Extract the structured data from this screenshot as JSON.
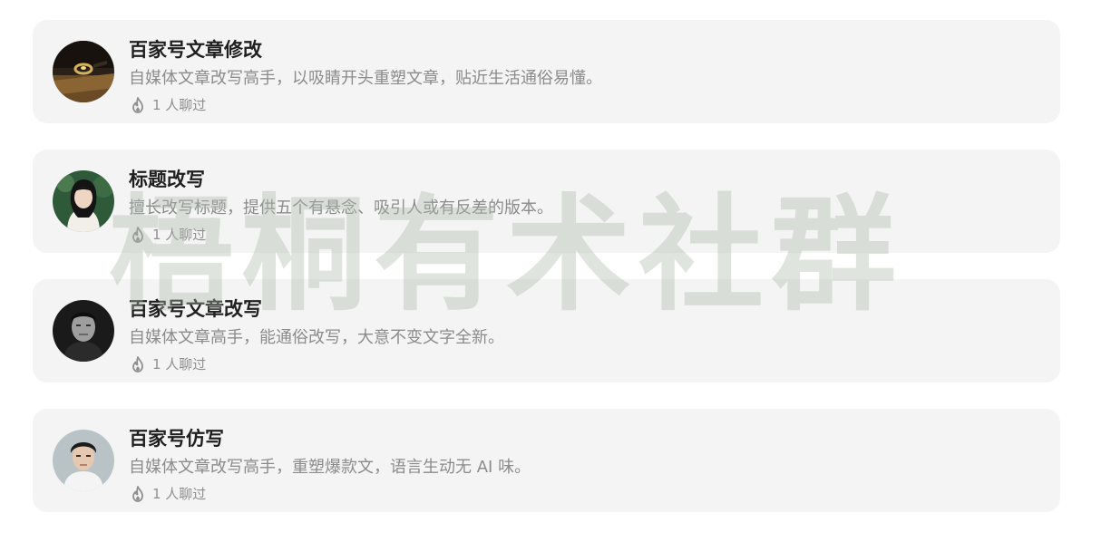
{
  "items": [
    {
      "title": "百家号文章修改",
      "description": "自媒体文章改写高手，以吸睛开头重塑文章，贴近生活通俗易懂。",
      "chat_count": "1 人聊过",
      "avatar": "gold-ring-photo"
    },
    {
      "title": "标题改写",
      "description": "擅长改写标题，提供五个有悬念、吸引人或有反差的版本。",
      "chat_count": "1 人聊过",
      "avatar": "young-woman-portrait"
    },
    {
      "title": "百家号文章改写",
      "description": "自媒体文章高手，能通俗改写，大意不变文字全新。",
      "chat_count": "1 人聊过",
      "avatar": "man-bw-portrait"
    },
    {
      "title": "百家号仿写",
      "description": "自媒体文章改写高手，重塑爆款文，语言生动无 AI 味。",
      "chat_count": "1 人聊过",
      "avatar": "young-man-portrait"
    }
  ],
  "watermark": "梧桐有术社群",
  "colors": {
    "card_bg": "#f4f4f4",
    "title": "#1f1f1f",
    "description": "#8b8b8b",
    "watermark": "#b8c4b9"
  }
}
